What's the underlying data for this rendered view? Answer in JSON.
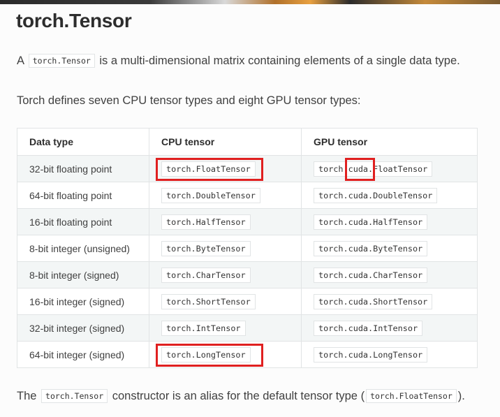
{
  "title": "torch.Tensor",
  "intro": {
    "prefix": "A",
    "code": "torch.Tensor",
    "suffix": "is a multi-dimensional matrix containing elements of a single data type."
  },
  "types_sentence": "Torch defines seven CPU tensor types and eight GPU tensor types:",
  "table": {
    "headers": [
      "Data type",
      "CPU tensor",
      "GPU tensor"
    ],
    "rows": [
      {
        "type": "32-bit floating point",
        "cpu": "torch.FloatTensor",
        "gpu": "torch.cuda.FloatTensor"
      },
      {
        "type": "64-bit floating point",
        "cpu": "torch.DoubleTensor",
        "gpu": "torch.cuda.DoubleTensor"
      },
      {
        "type": "16-bit floating point",
        "cpu": "torch.HalfTensor",
        "gpu": "torch.cuda.HalfTensor"
      },
      {
        "type": "8-bit integer (unsigned)",
        "cpu": "torch.ByteTensor",
        "gpu": "torch.cuda.ByteTensor"
      },
      {
        "type": "8-bit integer (signed)",
        "cpu": "torch.CharTensor",
        "gpu": "torch.cuda.CharTensor"
      },
      {
        "type": "16-bit integer (signed)",
        "cpu": "torch.ShortTensor",
        "gpu": "torch.cuda.ShortTensor"
      },
      {
        "type": "32-bit integer (signed)",
        "cpu": "torch.IntTensor",
        "gpu": "torch.cuda.IntTensor"
      },
      {
        "type": "64-bit integer (signed)",
        "cpu": "torch.LongTensor",
        "gpu": "torch.cuda.LongTensor"
      }
    ]
  },
  "footer": {
    "prefix": "The",
    "code1": "torch.Tensor",
    "middle": "constructor is an alias for the default tensor type (",
    "code2": "torch.FloatTensor",
    "suffix": ")."
  },
  "colors": {
    "highlight": "#e02020",
    "text": "#404040",
    "stripe": "#f3f6f6"
  }
}
